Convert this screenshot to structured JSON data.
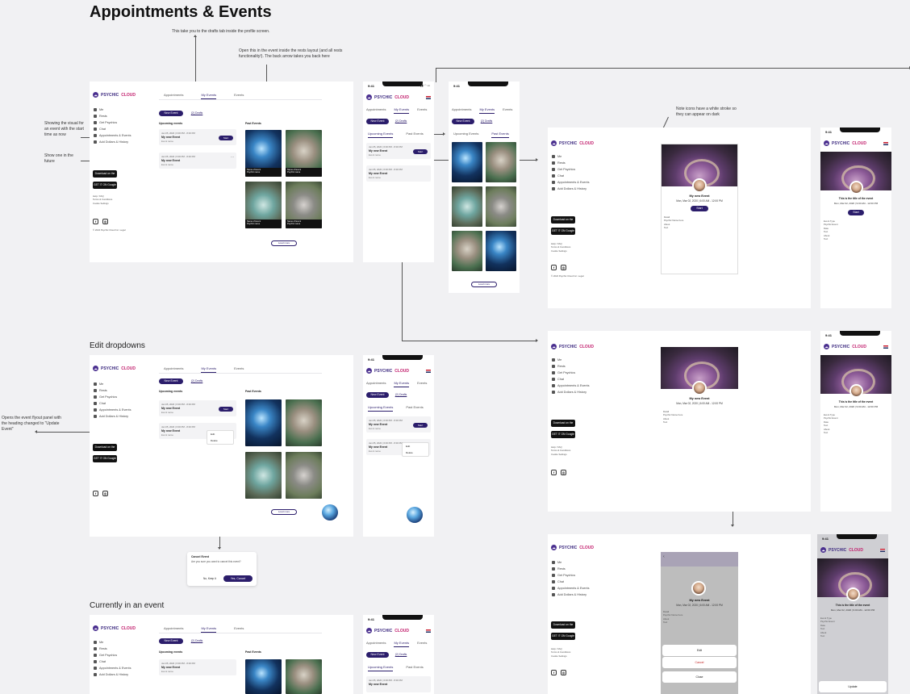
{
  "board": {
    "title": "Appointments & Events",
    "sections": [
      "Edit dropdowns",
      "Currently in an event"
    ]
  },
  "notes": {
    "drafts": "This take you to the drafts tab inside the profile screen.",
    "open_event": "Open this in the event inside the rests layout (and all rests functionality!). The back arrow takes you back here",
    "visual_now": "Showing the visual for an event with the start time as now",
    "show_future": "Show one in the future",
    "icons_stroke": "Note icons have a white stroke so they can appear on dark",
    "flyout": "Opens the event flyout panel with the heading changed to \"Update Event\""
  },
  "brand": {
    "psychic": "PSYCHIC",
    "cloud": "CLOUD",
    "accent": "#2b1d6b",
    "pink": "#c21f6d"
  },
  "phone": {
    "time": "9:41",
    "status": "▮▮ ◠ ▭"
  },
  "tabs": {
    "appointments": "Appointments",
    "my_events": "My Events",
    "events": "Events"
  },
  "actions": {
    "new_event": "New Event",
    "drafts": "(2) Drafts",
    "load_more": "Load more"
  },
  "subtabs": {
    "upcoming": "Upcoming Events",
    "past": "Past Events"
  },
  "headings": {
    "upcoming": "Upcoming events",
    "past": "Past Events"
  },
  "sidebar": {
    "items": [
      "Me",
      "Rests",
      "Get Psychics",
      "Chat",
      "Appointments & Events",
      "Add Dollars & History"
    ],
    "store_apple": "Download on the App Store",
    "store_google": "GET IT ON Google Play",
    "footer": "© 2024 Psychic Cloud Inc. Legal",
    "links": "Help / FAQ\nTerms & Conditions\nCookie Settings"
  },
  "event_cards": [
    {
      "date": "Jan 05, 2020  |  6:00 PM - 8:00 PM",
      "name": "My new Event",
      "desc": "Event name",
      "btn": "Start"
    },
    {
      "date": "Jan 05, 2020  |  6:00 PM - 8:00 PM",
      "name": "My new Event",
      "desc": "Event name",
      "btn": ""
    }
  ],
  "tiles": [
    {
      "title": "Name of Event",
      "host": "Psychic name",
      "count": "12"
    },
    {
      "title": "Name of Event",
      "host": "Psychic name",
      "count": "12"
    },
    {
      "title": "Name of Event",
      "host": "Psychic name",
      "count": "12"
    },
    {
      "title": "Name of Event",
      "host": "Psychic name",
      "count": "12"
    }
  ],
  "detail": {
    "title": "My new Event",
    "date": "Mon, Mar 02, 2020 | 6:00 AM - 12:00 PM",
    "start": "Start",
    "fields": "Detail\nPsychic Name here\nAbout\nText",
    "phone_title": "This is the title of the event",
    "phone_date": "Mon, Mar 02, 2020 | 9:00 AM - 12:00 PM",
    "phone_fields": "Event Type\nPsychic Event\nDate\nText\nAbout\nText"
  },
  "dropdown": {
    "edit": "Edit",
    "delete": "Delete"
  },
  "sheet": {
    "edit": "Edit",
    "cancel": "Cancel",
    "close": "Close",
    "update": "Update"
  },
  "dialog": {
    "title": "Cancel Event",
    "body": "Are you sure you want to cancel this event?",
    "no": "No, Keep it",
    "yes": "Yes, Cancel"
  }
}
